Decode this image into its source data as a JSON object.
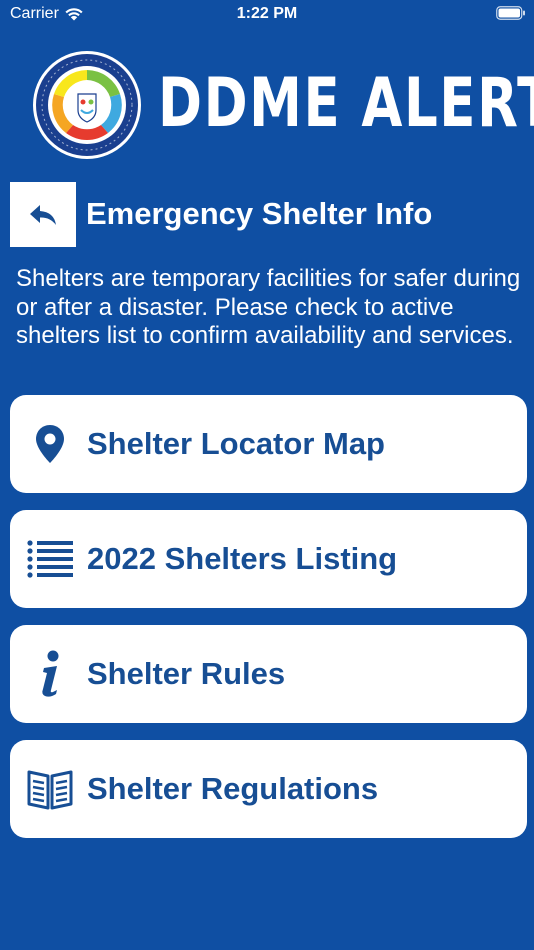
{
  "status_bar": {
    "carrier": "Carrier",
    "time": "1:22 PM",
    "wifi_icon": "wifi-icon",
    "battery_icon": "battery-icon"
  },
  "header": {
    "app_title": "DDME ALERT",
    "logo_icon": "ddme-seal-logo"
  },
  "page": {
    "title": "Emergency Shelter Info",
    "back_icon": "back-arrow-icon",
    "description": "Shelters are temporary facilities for safer during or after a disaster. Please check to active shelters list to confirm availability and services."
  },
  "menu": {
    "items": [
      {
        "label": "Shelter Locator Map",
        "icon": "map-pin-icon"
      },
      {
        "label": "2022 Shelters Listing",
        "icon": "list-icon"
      },
      {
        "label": "Shelter Rules",
        "icon": "info-icon"
      },
      {
        "label": "Shelter Regulations",
        "icon": "book-icon"
      }
    ]
  },
  "colors": {
    "background": "#0f4fa3",
    "card": "#ffffff",
    "card_text": "#174e94",
    "text": "#ffffff"
  }
}
